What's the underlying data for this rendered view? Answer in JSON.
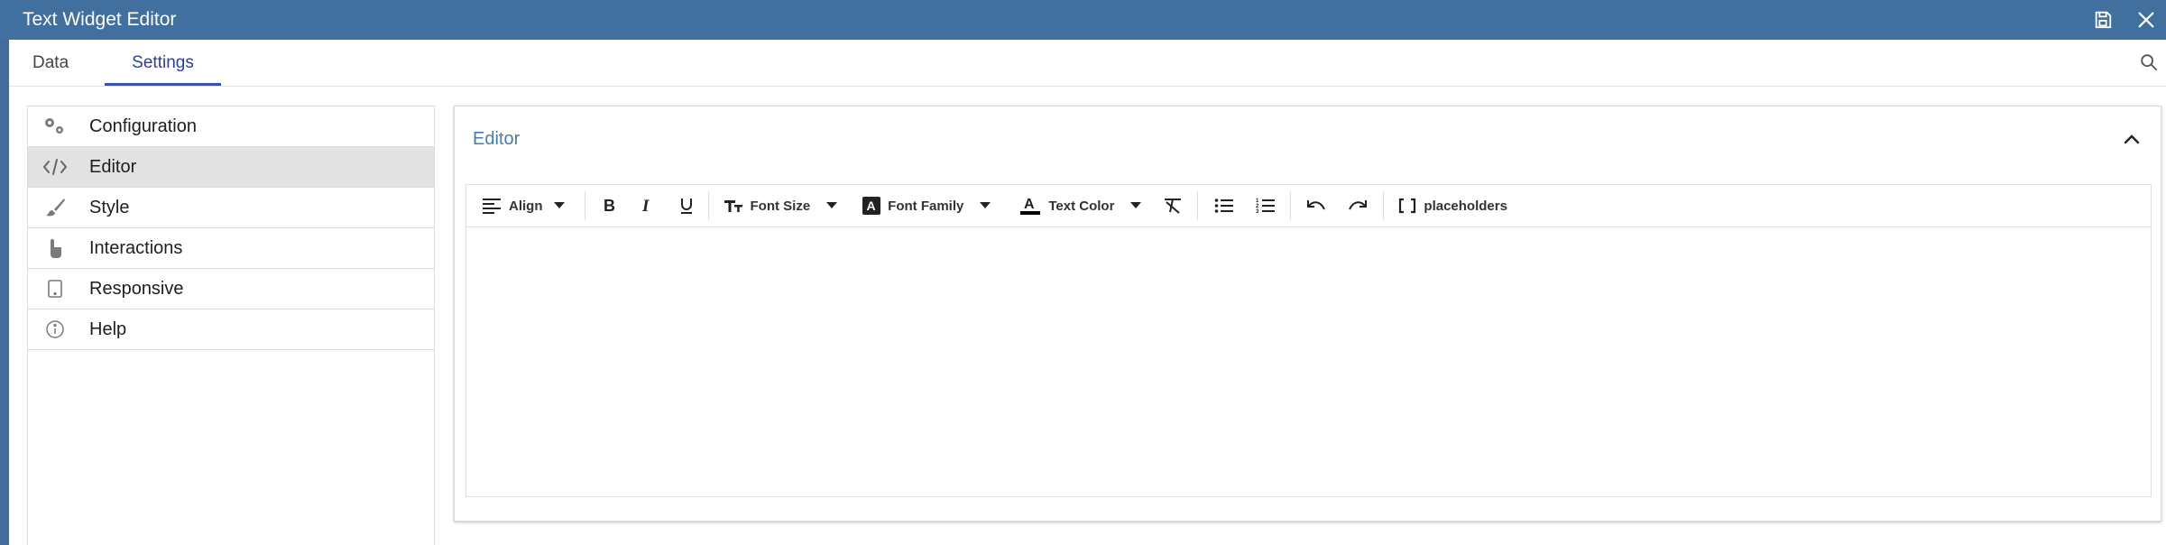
{
  "window": {
    "title": "Text Widget Editor",
    "actions": [
      {
        "name": "save",
        "icon": "save-icon"
      },
      {
        "name": "close",
        "icon": "close-icon"
      }
    ]
  },
  "tabs": [
    {
      "label": "Data",
      "active": false
    },
    {
      "label": "Settings",
      "active": true
    }
  ],
  "search": {
    "icon": "search-icon"
  },
  "sidebar": {
    "items": [
      {
        "label": "Configuration",
        "icon": "gears-icon",
        "active": false
      },
      {
        "label": "Editor",
        "icon": "code-icon",
        "active": true
      },
      {
        "label": "Style",
        "icon": "brush-icon",
        "active": false
      },
      {
        "label": "Interactions",
        "icon": "pointer-hand-icon",
        "active": false
      },
      {
        "label": "Responsive",
        "icon": "tablet-icon",
        "active": false
      },
      {
        "label": "Help",
        "icon": "info-icon",
        "active": false
      }
    ]
  },
  "editor_panel": {
    "title": "Editor",
    "collapse_icon": "chevron-up-icon",
    "toolbar": {
      "align_label": "Align",
      "bold_icon": "bold-icon",
      "italic_icon": "italic-icon",
      "underline_icon": "underline-icon",
      "font_size_label": "Font Size",
      "font_family_label": "Font Family",
      "text_color_label": "Text Color",
      "text_color_value": "#000000",
      "clear_format_icon": "clear-format-icon",
      "bullet_list_icon": "bullet-list-icon",
      "numbered_list_icon": "numbered-list-icon",
      "undo_icon": "undo-icon",
      "redo_icon": "redo-icon",
      "placeholders_label": "placeholders"
    },
    "content": ""
  },
  "colors": {
    "titlebar": "#41709e",
    "accent": "#3a4fb0",
    "panel_title": "#4a7bb0",
    "active_menu_bg": "#e2e2e2"
  }
}
